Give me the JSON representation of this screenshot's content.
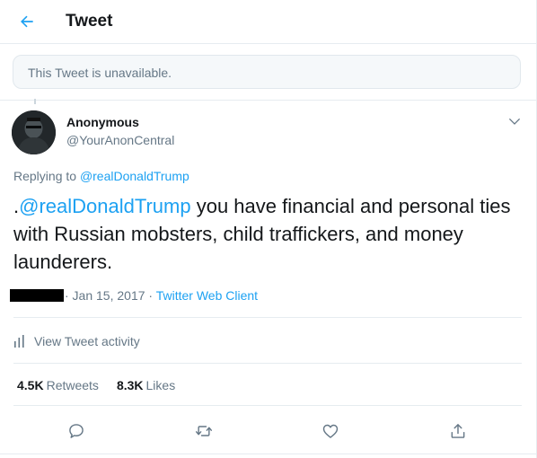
{
  "header": {
    "title": "Tweet",
    "back_icon": "arrow-left-icon"
  },
  "notice": {
    "text": "This Tweet is unavailable."
  },
  "tweet": {
    "author_name": "Anonymous",
    "author_handle": "@YourAnonCentral",
    "replying_prefix": "Replying to ",
    "replying_to": "@realDonaldTrump",
    "text_prefix": ".",
    "text_mention": "@realDonaldTrump",
    "text_body": " you have financial and personal ties with Russian mobsters, child traffickers, and money launderers.",
    "date": "· Jan 15, 2017 · ",
    "client": "Twitter Web Client",
    "activity_label": "View Tweet activity",
    "retweets_count": "4.5K",
    "retweets_label": "Retweets",
    "likes_count": "8.3K",
    "likes_label": "Likes"
  },
  "actions": [
    {
      "name": "reply-icon"
    },
    {
      "name": "retweet-icon"
    },
    {
      "name": "like-icon"
    },
    {
      "name": "share-icon"
    }
  ],
  "colors": {
    "accent": "#1da1f2",
    "text_primary": "#14171a",
    "text_secondary": "#657786",
    "border": "#e6ecf0"
  }
}
